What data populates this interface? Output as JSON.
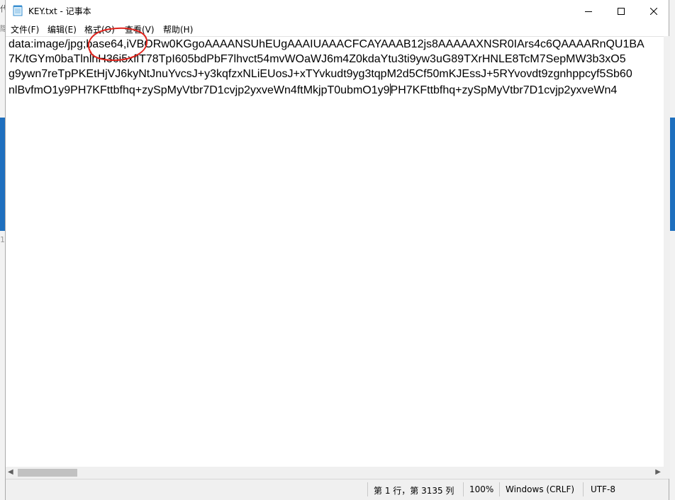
{
  "window": {
    "title": "KEY.txt - 记事本"
  },
  "menu": [
    "文件(F)",
    "编辑(E)",
    "格式(O)",
    "查看(V)",
    "帮助(H)"
  ],
  "editor": {
    "lines": [
      "data:image/jpg;base64,iVBORw0KGgoAAAANSUhEUgAAAIUAAACFCAYAAAB12js8AAAAAXNSR0IArs4c6QAAAARnQU1BA",
      "7K/tGYm0baTlnlhH36i5xflT78TpI605bdPbF7lhvct54mvWOaWJ6m4Z0kdaYtu3ti9yw3uG89TXrHNLE8TcM7SepMW3b3xO5",
      "g9ywn7reTpPKEtHjVJ6kyNtJnuYvcsJ+y3kqfzxNLiEUosJ+xTYvkudt9yg3tqpM2d5Cf50mKJEssJ+5RYvovdt9zgnhppcyf5Sb60"
    ],
    "line4_before_caret": "nlBvfmO1y9PH7KFttbfhq+zySpMyVtbr7D1cvjp2yxveWn4ftMkjpT0ubmO1y9",
    "line4_after_caret": "PH7KFttbfhq+zySpMyVtbr7D1cvjp2yxveWn4"
  },
  "status": {
    "position": "第 1 行，第 3135 列",
    "zoom": "100%",
    "line_ending": "Windows (CRLF)",
    "encoding": "UTF-8"
  },
  "colors": {
    "annotation": "#e0231c",
    "desktop_accent": "#1e6fbe"
  }
}
